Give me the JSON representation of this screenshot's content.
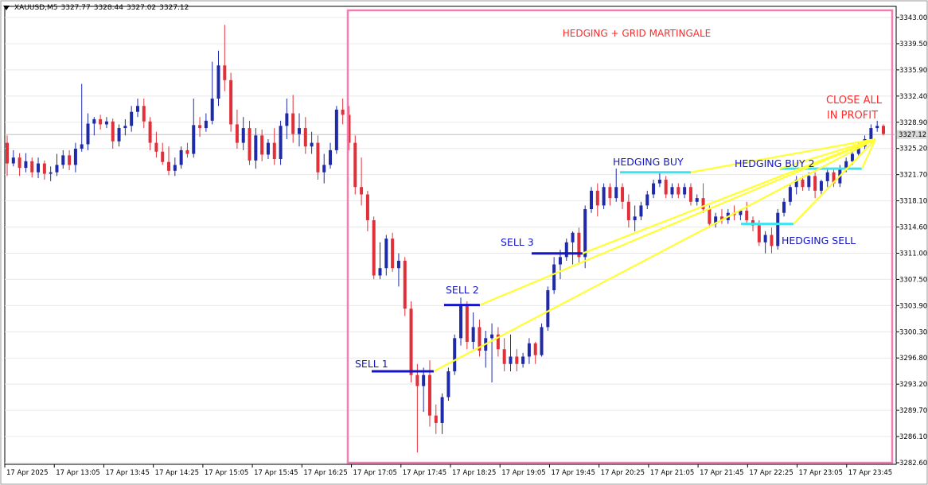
{
  "header": {
    "symbol": "XAUUSD,M5",
    "open": "3327.77",
    "high": "3328.44",
    "low": "3327.02",
    "close": "3327.12"
  },
  "colors": {
    "bull": "#1f2aa8",
    "bear": "#e0303a",
    "box": "#f07fb4",
    "yellow": "#ffff33",
    "cyan": "#3fe3f0",
    "navy": "#1515c8",
    "annotation_red": "#ff2a2a",
    "grid": "#e8e8e8",
    "price_tag_bg": "#d9d9d9"
  },
  "chart_data": {
    "type": "candlestick",
    "title": "HEDGING + GRID MARTINGALE",
    "y_ticks": [
      "3343.00",
      "3339.50",
      "3335.90",
      "3332.40",
      "3328.90",
      "3325.20",
      "3321.70",
      "3318.10",
      "3314.60",
      "3311.00",
      "3307.50",
      "3303.90",
      "3300.30",
      "3296.80",
      "3293.20",
      "3289.70",
      "3286.10",
      "3282.60"
    ],
    "ylim": [
      3282.6,
      3343.0
    ],
    "x_labels": [
      "17 Apr 2025",
      "17 Apr 13:05",
      "17 Apr 13:45",
      "17 Apr 14:25",
      "17 Apr 15:05",
      "17 Apr 15:45",
      "17 Apr 16:25",
      "17 Apr 17:05",
      "17 Apr 17:45",
      "17 Apr 18:25",
      "17 Apr 19:05",
      "17 Apr 19:45",
      "17 Apr 20:25",
      "17 Apr 21:05",
      "17 Apr 21:45",
      "17 Apr 22:25",
      "17 Apr 23:05",
      "17 Apr 23:45"
    ],
    "current_price": "3327.12",
    "candles": [
      {
        "o": 3326.0,
        "h": 3327.0,
        "l": 3321.5,
        "c": 3323.2
      },
      {
        "o": 3323.2,
        "h": 3325.0,
        "l": 3322.8,
        "c": 3324.0
      },
      {
        "o": 3324.0,
        "h": 3324.6,
        "l": 3321.5,
        "c": 3322.6
      },
      {
        "o": 3322.6,
        "h": 3324.6,
        "l": 3322.0,
        "c": 3323.5
      },
      {
        "o": 3323.5,
        "h": 3324.0,
        "l": 3321.3,
        "c": 3322.0
      },
      {
        "o": 3322.0,
        "h": 3324.0,
        "l": 3321.2,
        "c": 3323.2
      },
      {
        "o": 3323.2,
        "h": 3323.6,
        "l": 3321.0,
        "c": 3321.8
      },
      {
        "o": 3321.8,
        "h": 3322.8,
        "l": 3320.8,
        "c": 3322.0
      },
      {
        "o": 3322.0,
        "h": 3324.5,
        "l": 3321.5,
        "c": 3323.0
      },
      {
        "o": 3323.0,
        "h": 3325.0,
        "l": 3322.5,
        "c": 3324.3
      },
      {
        "o": 3324.3,
        "h": 3325.0,
        "l": 3322.3,
        "c": 3323.0
      },
      {
        "o": 3323.0,
        "h": 3326.0,
        "l": 3322.0,
        "c": 3325.2
      },
      {
        "o": 3325.2,
        "h": 3334.0,
        "l": 3324.8,
        "c": 3325.8
      },
      {
        "o": 3325.8,
        "h": 3330.0,
        "l": 3325.0,
        "c": 3328.6
      },
      {
        "o": 3328.6,
        "h": 3329.5,
        "l": 3327.0,
        "c": 3329.2
      },
      {
        "o": 3329.2,
        "h": 3329.8,
        "l": 3327.8,
        "c": 3328.5
      },
      {
        "o": 3328.5,
        "h": 3329.5,
        "l": 3328.0,
        "c": 3328.9
      },
      {
        "o": 3328.9,
        "h": 3329.3,
        "l": 3325.2,
        "c": 3326.2
      },
      {
        "o": 3326.2,
        "h": 3328.5,
        "l": 3325.5,
        "c": 3328.0
      },
      {
        "o": 3328.0,
        "h": 3329.2,
        "l": 3327.0,
        "c": 3328.3
      },
      {
        "o": 3328.3,
        "h": 3331.0,
        "l": 3327.5,
        "c": 3330.2
      },
      {
        "o": 3330.2,
        "h": 3332.0,
        "l": 3329.5,
        "c": 3331.0
      },
      {
        "o": 3331.0,
        "h": 3332.0,
        "l": 3328.0,
        "c": 3328.9
      },
      {
        "o": 3328.9,
        "h": 3329.5,
        "l": 3325.0,
        "c": 3326.0
      },
      {
        "o": 3326.0,
        "h": 3327.5,
        "l": 3324.0,
        "c": 3324.8
      },
      {
        "o": 3324.8,
        "h": 3326.0,
        "l": 3323.0,
        "c": 3323.4
      },
      {
        "o": 3323.4,
        "h": 3325.5,
        "l": 3321.6,
        "c": 3322.2
      },
      {
        "o": 3322.2,
        "h": 3324.0,
        "l": 3321.5,
        "c": 3323.0
      },
      {
        "o": 3323.0,
        "h": 3325.5,
        "l": 3322.5,
        "c": 3325.0
      },
      {
        "o": 3325.0,
        "h": 3326.0,
        "l": 3324.0,
        "c": 3324.5
      },
      {
        "o": 3324.5,
        "h": 3332.0,
        "l": 3324.0,
        "c": 3328.4
      },
      {
        "o": 3328.4,
        "h": 3329.5,
        "l": 3326.8,
        "c": 3328.0
      },
      {
        "o": 3328.0,
        "h": 3330.0,
        "l": 3327.5,
        "c": 3329.0
      },
      {
        "o": 3329.0,
        "h": 3337.0,
        "l": 3328.5,
        "c": 3332.0
      },
      {
        "o": 3332.0,
        "h": 3338.5,
        "l": 3331.0,
        "c": 3336.5
      },
      {
        "o": 3336.5,
        "h": 3342.0,
        "l": 3333.0,
        "c": 3334.5
      },
      {
        "o": 3334.5,
        "h": 3335.5,
        "l": 3327.5,
        "c": 3328.5
      },
      {
        "o": 3328.5,
        "h": 3330.5,
        "l": 3325.2,
        "c": 3326.0
      },
      {
        "o": 3326.0,
        "h": 3329.5,
        "l": 3325.0,
        "c": 3328.0
      },
      {
        "o": 3328.0,
        "h": 3329.0,
        "l": 3323.0,
        "c": 3323.6
      },
      {
        "o": 3323.6,
        "h": 3328.0,
        "l": 3322.5,
        "c": 3327.0
      },
      {
        "o": 3327.0,
        "h": 3327.8,
        "l": 3323.5,
        "c": 3324.4
      },
      {
        "o": 3324.4,
        "h": 3326.5,
        "l": 3323.8,
        "c": 3326.0
      },
      {
        "o": 3326.0,
        "h": 3328.0,
        "l": 3323.0,
        "c": 3323.8
      },
      {
        "o": 3323.8,
        "h": 3329.0,
        "l": 3323.0,
        "c": 3328.3
      },
      {
        "o": 3328.3,
        "h": 3332.0,
        "l": 3326.5,
        "c": 3330.0
      },
      {
        "o": 3330.0,
        "h": 3332.5,
        "l": 3326.0,
        "c": 3327.2
      },
      {
        "o": 3327.2,
        "h": 3330.0,
        "l": 3325.5,
        "c": 3328.0
      },
      {
        "o": 3328.0,
        "h": 3329.5,
        "l": 3324.5,
        "c": 3325.5
      },
      {
        "o": 3325.5,
        "h": 3327.5,
        "l": 3324.5,
        "c": 3326.0
      },
      {
        "o": 3326.0,
        "h": 3327.0,
        "l": 3321.0,
        "c": 3322.0
      },
      {
        "o": 3322.0,
        "h": 3324.5,
        "l": 3320.5,
        "c": 3323.0
      },
      {
        "o": 3323.0,
        "h": 3326.0,
        "l": 3322.5,
        "c": 3325.0
      },
      {
        "o": 3325.0,
        "h": 3331.0,
        "l": 3324.5,
        "c": 3330.5
      },
      {
        "o": 3330.5,
        "h": 3332.0,
        "l": 3328.5,
        "c": 3329.8
      },
      {
        "o": 3329.8,
        "h": 3331.0,
        "l": 3325.0,
        "c": 3326.0
      },
      {
        "o": 3326.0,
        "h": 3327.0,
        "l": 3319.0,
        "c": 3320.0
      },
      {
        "o": 3320.0,
        "h": 3324.0,
        "l": 3317.5,
        "c": 3319.0
      },
      {
        "o": 3319.0,
        "h": 3319.5,
        "l": 3314.0,
        "c": 3315.5
      },
      {
        "o": 3315.5,
        "h": 3316.0,
        "l": 3307.5,
        "c": 3308.0
      },
      {
        "o": 3308.0,
        "h": 3312.5,
        "l": 3307.5,
        "c": 3309.0
      },
      {
        "o": 3309.0,
        "h": 3313.5,
        "l": 3308.0,
        "c": 3313.0
      },
      {
        "o": 3313.0,
        "h": 3313.8,
        "l": 3308.5,
        "c": 3309.0
      },
      {
        "o": 3309.0,
        "h": 3311.0,
        "l": 3306.5,
        "c": 3310.0
      },
      {
        "o": 3310.0,
        "h": 3310.5,
        "l": 3302.5,
        "c": 3303.5
      },
      {
        "o": 3303.5,
        "h": 3304.5,
        "l": 3293.5,
        "c": 3294.5
      },
      {
        "o": 3294.5,
        "h": 3296.0,
        "l": 3284.0,
        "c": 3293.0
      },
      {
        "o": 3293.0,
        "h": 3295.5,
        "l": 3289.5,
        "c": 3294.5
      },
      {
        "o": 3294.5,
        "h": 3296.5,
        "l": 3287.5,
        "c": 3289.0
      },
      {
        "o": 3289.0,
        "h": 3290.5,
        "l": 3286.5,
        "c": 3288.0
      },
      {
        "o": 3288.0,
        "h": 3292.0,
        "l": 3286.5,
        "c": 3291.5
      },
      {
        "o": 3291.5,
        "h": 3295.5,
        "l": 3291.0,
        "c": 3295.0
      },
      {
        "o": 3295.0,
        "h": 3300.0,
        "l": 3294.5,
        "c": 3299.5
      },
      {
        "o": 3299.5,
        "h": 3305.0,
        "l": 3298.5,
        "c": 3304.0
      },
      {
        "o": 3304.0,
        "h": 3304.5,
        "l": 3298.0,
        "c": 3299.0
      },
      {
        "o": 3299.0,
        "h": 3303.0,
        "l": 3298.0,
        "c": 3301.0
      },
      {
        "o": 3301.0,
        "h": 3302.0,
        "l": 3297.0,
        "c": 3297.8
      },
      {
        "o": 3297.8,
        "h": 3300.5,
        "l": 3295.5,
        "c": 3299.5
      },
      {
        "o": 3299.5,
        "h": 3301.5,
        "l": 3293.5,
        "c": 3300.0
      },
      {
        "o": 3300.0,
        "h": 3301.0,
        "l": 3297.0,
        "c": 3298.0
      },
      {
        "o": 3298.0,
        "h": 3299.5,
        "l": 3295.0,
        "c": 3296.0
      },
      {
        "o": 3296.0,
        "h": 3300.0,
        "l": 3295.0,
        "c": 3297.0
      },
      {
        "o": 3297.0,
        "h": 3298.0,
        "l": 3295.0,
        "c": 3296.0
      },
      {
        "o": 3296.0,
        "h": 3297.5,
        "l": 3295.5,
        "c": 3297.0
      },
      {
        "o": 3297.0,
        "h": 3299.5,
        "l": 3296.0,
        "c": 3298.8
      },
      {
        "o": 3298.8,
        "h": 3299.0,
        "l": 3296.0,
        "c": 3297.2
      },
      {
        "o": 3297.2,
        "h": 3301.5,
        "l": 3297.0,
        "c": 3301.0
      },
      {
        "o": 3301.0,
        "h": 3306.5,
        "l": 3300.5,
        "c": 3306.0
      },
      {
        "o": 3306.0,
        "h": 3310.5,
        "l": 3305.5,
        "c": 3309.5
      },
      {
        "o": 3309.5,
        "h": 3311.5,
        "l": 3307.5,
        "c": 3310.5
      },
      {
        "o": 3310.5,
        "h": 3313.0,
        "l": 3310.0,
        "c": 3312.5
      },
      {
        "o": 3312.5,
        "h": 3314.0,
        "l": 3309.5,
        "c": 3313.8
      },
      {
        "o": 3313.8,
        "h": 3314.5,
        "l": 3309.5,
        "c": 3310.5
      },
      {
        "o": 3310.5,
        "h": 3317.5,
        "l": 3309.0,
        "c": 3317.0
      },
      {
        "o": 3317.0,
        "h": 3320.0,
        "l": 3316.5,
        "c": 3319.5
      },
      {
        "o": 3319.5,
        "h": 3320.5,
        "l": 3316.0,
        "c": 3317.5
      },
      {
        "o": 3317.5,
        "h": 3320.5,
        "l": 3317.0,
        "c": 3320.0
      },
      {
        "o": 3320.0,
        "h": 3320.5,
        "l": 3317.5,
        "c": 3318.5
      },
      {
        "o": 3318.5,
        "h": 3322.5,
        "l": 3318.0,
        "c": 3320.0
      },
      {
        "o": 3320.0,
        "h": 3320.5,
        "l": 3317.0,
        "c": 3318.0
      },
      {
        "o": 3318.0,
        "h": 3319.0,
        "l": 3314.5,
        "c": 3315.5
      },
      {
        "o": 3315.5,
        "h": 3317.5,
        "l": 3314.0,
        "c": 3316.0
      },
      {
        "o": 3316.0,
        "h": 3318.0,
        "l": 3315.5,
        "c": 3317.5
      },
      {
        "o": 3317.5,
        "h": 3319.5,
        "l": 3317.0,
        "c": 3319.0
      },
      {
        "o": 3319.0,
        "h": 3321.0,
        "l": 3318.5,
        "c": 3320.5
      },
      {
        "o": 3320.5,
        "h": 3322.0,
        "l": 3320.0,
        "c": 3321.0
      },
      {
        "o": 3321.0,
        "h": 3321.5,
        "l": 3318.5,
        "c": 3319.0
      },
      {
        "o": 3319.0,
        "h": 3320.5,
        "l": 3318.5,
        "c": 3320.0
      },
      {
        "o": 3320.0,
        "h": 3320.5,
        "l": 3318.5,
        "c": 3319.0
      },
      {
        "o": 3319.0,
        "h": 3320.5,
        "l": 3318.5,
        "c": 3320.0
      },
      {
        "o": 3320.0,
        "h": 3320.5,
        "l": 3317.5,
        "c": 3318.0
      },
      {
        "o": 3318.0,
        "h": 3319.0,
        "l": 3317.5,
        "c": 3318.5
      },
      {
        "o": 3318.5,
        "h": 3320.5,
        "l": 3316.5,
        "c": 3317.0
      },
      {
        "o": 3317.0,
        "h": 3317.5,
        "l": 3314.5,
        "c": 3315.0
      },
      {
        "o": 3315.0,
        "h": 3316.5,
        "l": 3314.5,
        "c": 3316.0
      },
      {
        "o": 3316.0,
        "h": 3317.0,
        "l": 3315.0,
        "c": 3315.5
      },
      {
        "o": 3315.5,
        "h": 3317.0,
        "l": 3315.0,
        "c": 3316.5
      },
      {
        "o": 3316.5,
        "h": 3317.5,
        "l": 3315.5,
        "c": 3316.2
      },
      {
        "o": 3316.2,
        "h": 3317.0,
        "l": 3315.5,
        "c": 3316.8
      },
      {
        "o": 3316.8,
        "h": 3318.0,
        "l": 3315.0,
        "c": 3315.5
      },
      {
        "o": 3315.5,
        "h": 3316.0,
        "l": 3314.0,
        "c": 3314.8
      },
      {
        "o": 3314.8,
        "h": 3315.5,
        "l": 3312.0,
        "c": 3312.5
      },
      {
        "o": 3312.5,
        "h": 3314.0,
        "l": 3311.0,
        "c": 3313.5
      },
      {
        "o": 3313.5,
        "h": 3314.5,
        "l": 3311.0,
        "c": 3312.0
      },
      {
        "o": 3312.0,
        "h": 3317.0,
        "l": 3311.5,
        "c": 3316.5
      },
      {
        "o": 3316.5,
        "h": 3318.5,
        "l": 3316.0,
        "c": 3318.0
      },
      {
        "o": 3318.0,
        "h": 3320.5,
        "l": 3317.5,
        "c": 3320.0
      },
      {
        "o": 3320.0,
        "h": 3321.5,
        "l": 3319.0,
        "c": 3321.0
      },
      {
        "o": 3321.0,
        "h": 3321.5,
        "l": 3319.5,
        "c": 3320.0
      },
      {
        "o": 3320.0,
        "h": 3322.0,
        "l": 3319.5,
        "c": 3321.5
      },
      {
        "o": 3321.5,
        "h": 3322.0,
        "l": 3318.5,
        "c": 3319.5
      },
      {
        "o": 3319.5,
        "h": 3321.0,
        "l": 3319.0,
        "c": 3320.8
      },
      {
        "o": 3320.8,
        "h": 3322.5,
        "l": 3320.0,
        "c": 3322.0
      },
      {
        "o": 3322.0,
        "h": 3322.5,
        "l": 3320.0,
        "c": 3320.5
      },
      {
        "o": 3320.5,
        "h": 3323.0,
        "l": 3320.0,
        "c": 3322.5
      },
      {
        "o": 3322.5,
        "h": 3324.0,
        "l": 3322.0,
        "c": 3323.5
      },
      {
        "o": 3323.5,
        "h": 3325.0,
        "l": 3323.0,
        "c": 3324.5
      },
      {
        "o": 3324.5,
        "h": 3326.0,
        "l": 3324.0,
        "c": 3325.5
      },
      {
        "o": 3325.5,
        "h": 3327.0,
        "l": 3325.0,
        "c": 3326.5
      },
      {
        "o": 3326.5,
        "h": 3328.5,
        "l": 3326.0,
        "c": 3328.0
      },
      {
        "o": 3328.0,
        "h": 3329.0,
        "l": 3327.5,
        "c": 3328.3
      },
      {
        "o": 3328.3,
        "h": 3328.5,
        "l": 3327.0,
        "c": 3327.2
      }
    ],
    "annotations": {
      "close_line1": "CLOSE ALL",
      "close_line2": "IN PROFIT",
      "sell1": "SELL 1",
      "sell2": "SELL 2",
      "sell3": "SELL 3",
      "hedging_buy": "HEDGING BUY",
      "hedging_buy2": "HEDGING BUY 2",
      "hedging_sell": "HEDGING SELL"
    },
    "levels": {
      "sell1": 3295.0,
      "sell2": 3304.0,
      "sell3": 3311.0,
      "hedging_buy": 3322.0,
      "hedging_buy2": 3322.5,
      "hedging_sell": 3315.0,
      "close_point": 3326.5
    }
  }
}
